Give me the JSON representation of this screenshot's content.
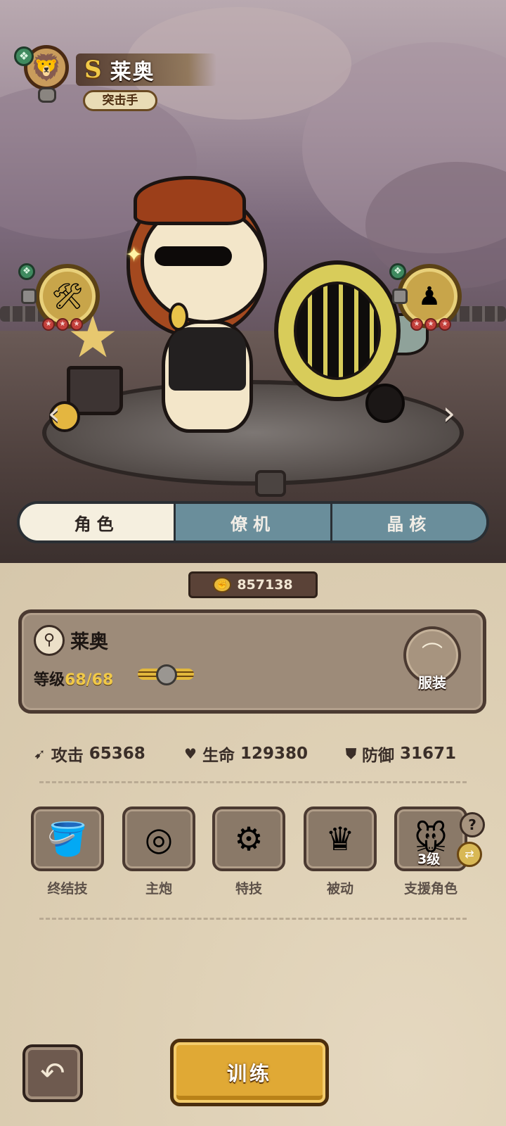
{
  "header": {
    "rank": "S",
    "hero_name": "莱奥",
    "role": "突击手",
    "rarity_icon": "clover-rune-icon",
    "medal_icon": "medal-icon"
  },
  "scene": {
    "left_arrow": "‹",
    "right_arrow": "›",
    "left_medallion": {
      "icon": "vehicle-icon",
      "stars": 3
    },
    "right_medallion": {
      "icon": "figure-icon",
      "stars": 3
    }
  },
  "tabs": [
    {
      "label": "角色",
      "active": true
    },
    {
      "label": "僚机",
      "active": false
    },
    {
      "label": "晶核",
      "active": false
    }
  ],
  "currency": {
    "icon": "fist-coin-icon",
    "value": "857138"
  },
  "card": {
    "name": "莱奥",
    "level_label": "等级",
    "level_value": "68/68",
    "outfit_label": "服装"
  },
  "stats": {
    "attack": {
      "label": "攻击",
      "value": "65368",
      "icon": "sword-icon"
    },
    "health": {
      "label": "生命",
      "value": "129380",
      "icon": "heart-icon"
    },
    "defense": {
      "label": "防御",
      "value": "31671",
      "icon": "shield-icon"
    }
  },
  "skills": [
    {
      "label": "终结技",
      "icon": "bucket-burst-icon"
    },
    {
      "label": "主炮",
      "icon": "ring-cannon-icon"
    },
    {
      "label": "特技",
      "icon": "gear-icon"
    },
    {
      "label": "被动",
      "icon": "crown-arch-icon"
    },
    {
      "label": "支援角色",
      "icon": "mouse-portrait-icon",
      "level": "3级"
    }
  ],
  "buttons": {
    "back": "↶",
    "train": "训练",
    "help": "?"
  },
  "colors": {
    "tab_active": "#f5efdf",
    "tab_inactive": "#6a8e9b",
    "train_button": "#e0a935",
    "rank_gold": "#f1c948"
  }
}
